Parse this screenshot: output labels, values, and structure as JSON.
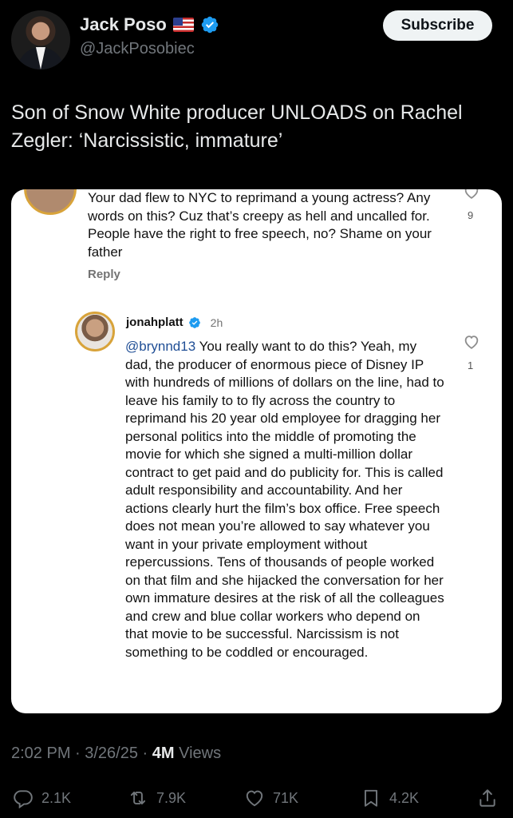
{
  "author": {
    "name": "Jack Poso",
    "handle": "@JackPosobiec",
    "flag_emoji": "🇺🇸",
    "verified_color": "#1d9bf0"
  },
  "subscribe_label": "Subscribe",
  "tweet_text": "Son of Snow White producer UNLOADS on Rachel Zegler: ‘Narcissistic, immature’",
  "media": {
    "comment_1": {
      "text": "Your dad flew to NYC to reprimand a young actress? Any words on this? Cuz that’s creepy as hell and uncalled for. People have the right to free speech, no? Shame on your father",
      "likes": "9",
      "reply_label": "Reply"
    },
    "comment_2": {
      "username": "jonahplatt",
      "time": "2h",
      "mention": "@brynnd13",
      "text": " You really want to do this? Yeah, my dad, the producer of enormous piece of Disney IP with hundreds of millions of dollars on the line, had to leave his family to to fly across the country to reprimand his 20 year old employee for dragging her personal politics into the middle of promoting the movie for which she signed a multi-million dollar contract to get paid and do publicity for. This is called adult responsibility and accountability. And her actions clearly hurt the film’s box office. Free speech does not mean you’re allowed to say whatever you want in your private employment without repercussions. Tens of thousands of people worked on that film and she hijacked the conversation for her own immature desires at the risk of all the colleagues and crew and blue collar workers who depend on that movie to be successful. Narcissism is not something to be coddled or encouraged.",
      "likes": "1"
    }
  },
  "meta": {
    "timestamp": "2:02 PM · 3/26/25 · ",
    "views_count": "4M",
    "views_label": " Views"
  },
  "actions": {
    "replies": "2.1K",
    "reposts": "7.9K",
    "likes": "71K",
    "bookmarks": "4.2K"
  }
}
